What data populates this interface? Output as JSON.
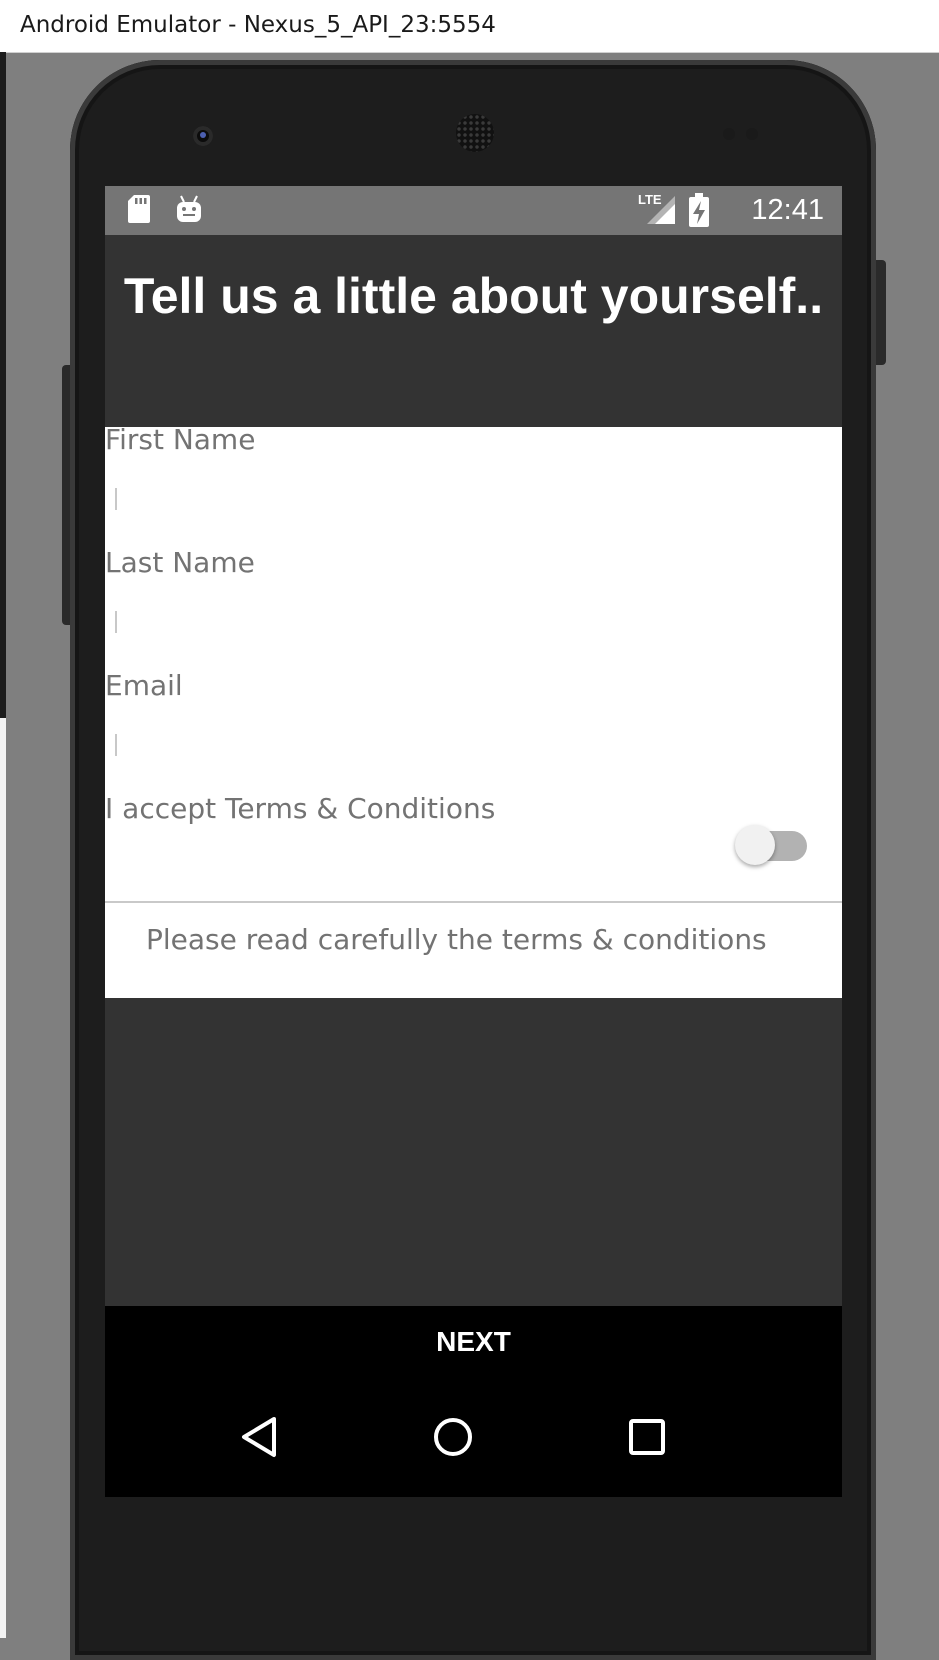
{
  "window": {
    "title": "Android Emulator - Nexus_5_API_23:5554"
  },
  "statusbar": {
    "time": "12:41",
    "icons": [
      "sd-card-icon",
      "android-debug-icon",
      "lte-signal-icon",
      "battery-charging-icon"
    ]
  },
  "header": {
    "title": "Tell us a little about yourself.."
  },
  "form": {
    "first_name": {
      "label": "First Name",
      "value": "",
      "placeholder": ""
    },
    "last_name": {
      "label": "Last Name",
      "value": "",
      "placeholder": ""
    },
    "email": {
      "label": "Email",
      "value": "",
      "placeholder": ""
    },
    "terms": {
      "label": "I accept Terms & Conditions",
      "checked": false,
      "note": "Please read carefully the terms & conditions"
    }
  },
  "actions": {
    "next_label": "NEXT"
  },
  "navigation": {
    "buttons": [
      "back-icon",
      "home-icon",
      "recents-icon"
    ]
  },
  "colors": {
    "header_bg": "#333333",
    "form_bg": "#ffffff",
    "label": "#737373",
    "next_bg": "#000000",
    "statusbar_bg": "#757575"
  }
}
